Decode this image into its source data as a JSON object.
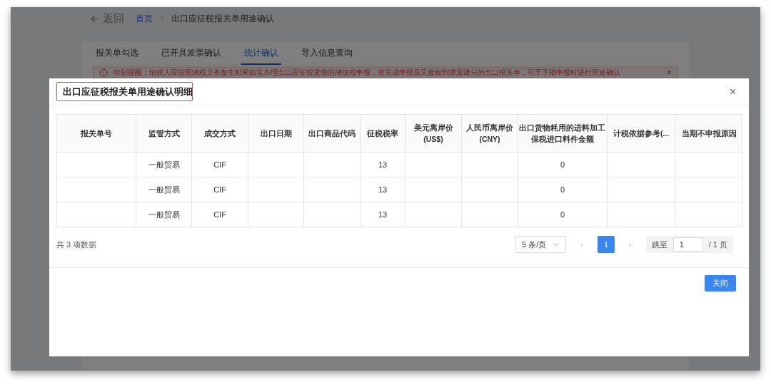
{
  "page": {
    "back": "返回",
    "breadcrumb": [
      "首页",
      "出口应征税报关单用途确认"
    ],
    "tabs": [
      {
        "label": "报关单勾选",
        "selected": false
      },
      {
        "label": "已开具发票确认",
        "selected": false
      },
      {
        "label": "统计确认",
        "selected": true
      },
      {
        "label": "导入信息查询",
        "selected": false
      }
    ],
    "notice": {
      "text": "特别提醒：纳税人应按照纳税义务发生时间如实办理出口应征税货物的增值税申报，若完成申报后又接收到滞后请分的出口报关单，可于下期申报时进行用途确认",
      "close": "×"
    }
  },
  "dialog": {
    "title": "出口应征税报关单用途确认明细",
    "close": "×",
    "table": {
      "columns": [
        "报关单号",
        "监管方式",
        "成交方式",
        "出口日期",
        "出口商品代码",
        "征税税率",
        "美元离岸价\n(US$)",
        "人民币离岸价\n(CNY)",
        "出口货物耗用的进料加工保税进口料件金额",
        "计税依据参考(...",
        "当期不申报原因"
      ],
      "rows": [
        [
          "",
          "一般贸易",
          "CIF",
          "",
          "",
          "13",
          "",
          "",
          "0",
          "",
          ""
        ],
        [
          "",
          "一般贸易",
          "CIF",
          "",
          "",
          "13",
          "",
          "",
          "0",
          "",
          ""
        ],
        [
          "",
          "一般贸易",
          "CIF",
          "",
          "",
          "13",
          "",
          "",
          "0",
          "",
          ""
        ]
      ]
    },
    "pagination": {
      "total": "共 3 项数据",
      "page_size": "5 条/页",
      "prev": "‹",
      "pages": [
        {
          "label": "1",
          "selected": true
        }
      ],
      "next": "›",
      "jump_label": "跳至",
      "jump_value": "1",
      "page_count": "/ 1 页"
    },
    "buttons": [
      "关闭"
    ]
  }
}
